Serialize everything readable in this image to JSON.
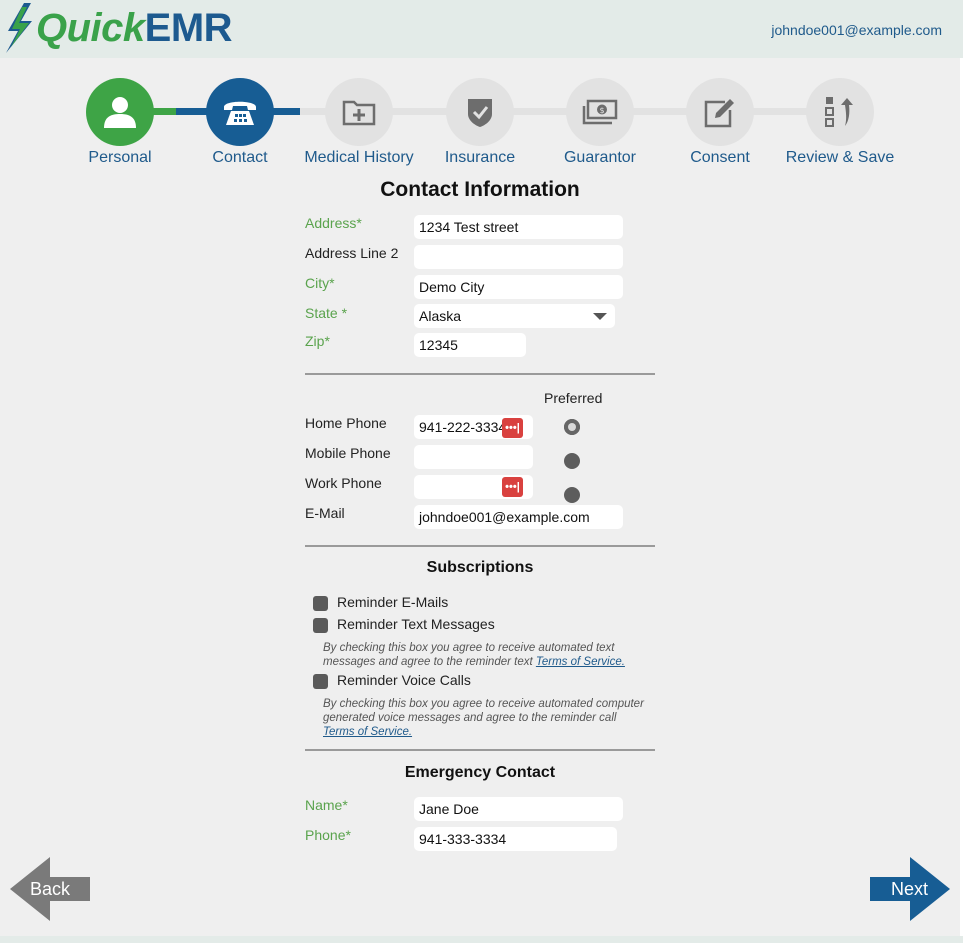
{
  "brand": {
    "quick": "Quick",
    "emr": "EMR"
  },
  "user": {
    "email": "johndoe001@example.com"
  },
  "steps": [
    {
      "label": "Personal",
      "icon": "user-icon",
      "state": "done"
    },
    {
      "label": "Contact",
      "icon": "telephone-icon",
      "state": "active"
    },
    {
      "label": "Medical History",
      "icon": "folder-plus-icon",
      "state": "todo"
    },
    {
      "label": "Insurance",
      "icon": "shield-check-icon",
      "state": "todo"
    },
    {
      "label": "Guarantor",
      "icon": "money-icon",
      "state": "todo"
    },
    {
      "label": "Consent",
      "icon": "edit-icon",
      "state": "todo"
    },
    {
      "label": "Review & Save",
      "icon": "review-icon",
      "state": "todo"
    }
  ],
  "contact": {
    "title": "Contact Information",
    "address": {
      "label": "Address*",
      "value": "1234 Test street"
    },
    "address2": {
      "label": "Address Line 2",
      "value": ""
    },
    "city": {
      "label": "City*",
      "value": "Demo City"
    },
    "state": {
      "label": "State *",
      "value": "Alaska"
    },
    "zip": {
      "label": "Zip*",
      "value": "12345"
    }
  },
  "phones": {
    "preferred_label": "Preferred",
    "home": {
      "label": "Home Phone",
      "value": "941-222-3334",
      "preferred": true
    },
    "mobile": {
      "label": "Mobile Phone",
      "value": "",
      "preferred": false
    },
    "work": {
      "label": "Work Phone",
      "value": "",
      "preferred": false
    },
    "email": {
      "label": "E-Mail",
      "value": "johndoe001@example.com"
    }
  },
  "subscriptions": {
    "title": "Subscriptions",
    "email_label": "Reminder E-Mails",
    "text_label": "Reminder Text Messages",
    "text_fine": "By checking this box you agree to receive automated text messages and agree to the reminder text",
    "voice_label": "Reminder Voice Calls",
    "voice_fine": "By checking this box you agree to receive automated computer generated voice messages and agree to the reminder call",
    "tos_link": "Terms of Service."
  },
  "emergency": {
    "title": "Emergency Contact",
    "name": {
      "label": "Name*",
      "value": "Jane Doe"
    },
    "phone": {
      "label": "Phone*",
      "value": "941-333-3334"
    }
  },
  "nav": {
    "back": "Back",
    "next": "Next"
  },
  "colors": {
    "green": "#3ea446",
    "blue": "#175d94",
    "inactive": "#e2e2e2",
    "danger": "#d9413f"
  }
}
